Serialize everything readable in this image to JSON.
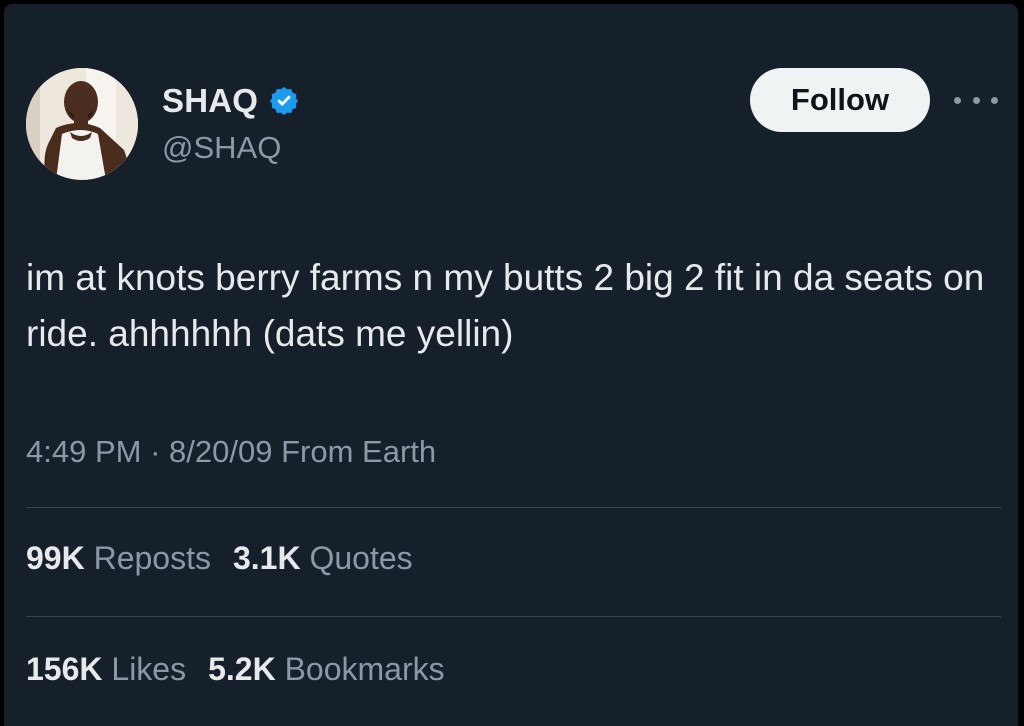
{
  "tweet": {
    "author": {
      "display_name": "SHAQ",
      "handle": "@SHAQ",
      "verified": true
    },
    "follow_label": "Follow",
    "more_icon": "more-horizontal-icon",
    "text": "im at knots berry farms n my butts 2 big 2 fit in da seats on ride. ahhhhhh (dats me yellin)",
    "time": "4:49 PM",
    "separator": "·",
    "date": "8/20/09",
    "source": "From Earth",
    "stats": {
      "reposts": {
        "count": "99K",
        "label": "Reposts"
      },
      "quotes": {
        "count": "3.1K",
        "label": "Quotes"
      },
      "likes": {
        "count": "156K",
        "label": "Likes"
      },
      "bookmarks": {
        "count": "5.2K",
        "label": "Bookmarks"
      }
    }
  },
  "colors": {
    "background": "#15202b",
    "text_primary": "#e7e9ea",
    "text_secondary": "#8b98a5",
    "verified_blue": "#1d9bf0",
    "follow_bg": "#eff3f4",
    "divider": "#38444d"
  }
}
